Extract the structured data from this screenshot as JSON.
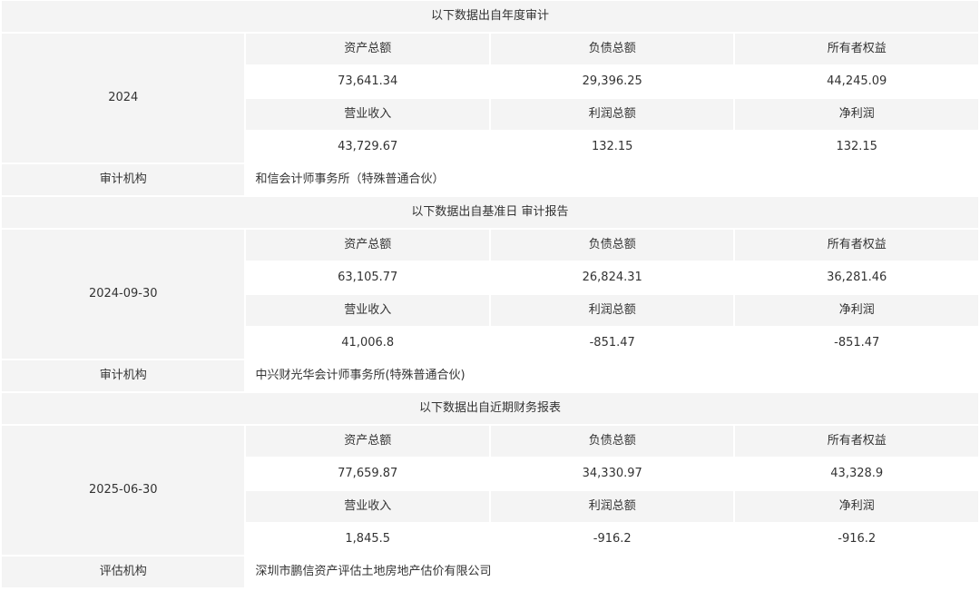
{
  "sections": [
    {
      "title": "以下数据出自年度审计",
      "period": "2024",
      "headers1": [
        "资产总额",
        "负债总额",
        "所有者权益"
      ],
      "values1": [
        "73,641.34",
        "29,396.25",
        "44,245.09"
      ],
      "headers2": [
        "营业收入",
        "利润总额",
        "净利润"
      ],
      "values2": [
        "43,729.67",
        "132.15",
        "132.15"
      ],
      "org_label": "审计机构",
      "org_name": "和信会计师事务所（特殊普通合伙）"
    },
    {
      "title": "以下数据出自基准日 审计报告",
      "period": "2024-09-30",
      "headers1": [
        "资产总额",
        "负债总额",
        "所有者权益"
      ],
      "values1": [
        "63,105.77",
        "26,824.31",
        "36,281.46"
      ],
      "headers2": [
        "营业收入",
        "利润总额",
        "净利润"
      ],
      "values2": [
        "41,006.8",
        "-851.47",
        "-851.47"
      ],
      "org_label": "审计机构",
      "org_name": "中兴财光华会计师事务所(特殊普通合伙)"
    },
    {
      "title": "以下数据出自近期财务报表",
      "period": "2025-06-30",
      "headers1": [
        "资产总额",
        "负债总额",
        "所有者权益"
      ],
      "values1": [
        "77,659.87",
        "34,330.97",
        "43,328.9"
      ],
      "headers2": [
        "营业收入",
        "利润总额",
        "净利润"
      ],
      "values2": [
        "1,845.5",
        "-916.2",
        "-916.2"
      ],
      "org_label": "评估机构",
      "org_name": "深圳市鹏信资产评估土地房地产估价有限公司"
    }
  ]
}
